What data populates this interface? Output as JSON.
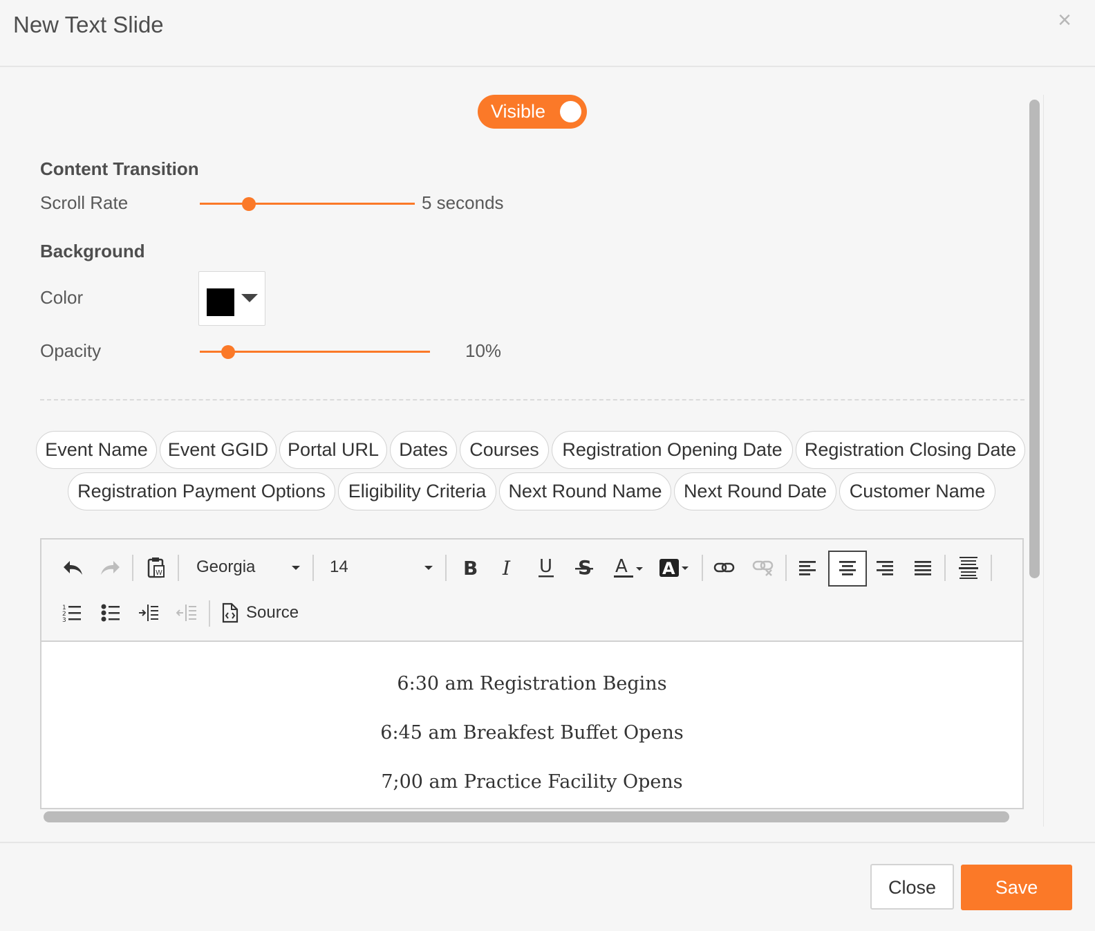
{
  "dialog": {
    "title": "New Text Slide",
    "close_icon": "×"
  },
  "toggle": {
    "label": "Visible",
    "state": "on",
    "color": "#fb7928"
  },
  "content_transition": {
    "heading": "Content Transition",
    "scroll_rate_label": "Scroll Rate",
    "scroll_rate_value": "5 seconds",
    "scroll_rate_fraction": 0.23
  },
  "background": {
    "heading": "Background",
    "color_label": "Color",
    "color_value": "#000000",
    "opacity_label": "Opacity",
    "opacity_value": "10%",
    "opacity_fraction": 0.1
  },
  "merge_fields": [
    "Event Name",
    "Event GGID",
    "Portal URL",
    "Dates",
    "Courses",
    "Registration Opening Date",
    "Registration Closing Date",
    "Registration Payment Options",
    "Eligibility Criteria",
    "Next Round Name",
    "Next Round Date",
    "Customer Name"
  ],
  "toolbar": {
    "font_family": "Georgia",
    "font_size": "14",
    "source_label": "Source",
    "icons": [
      "undo-icon",
      "redo-icon",
      "paste-from-word-icon",
      "bold-icon",
      "italic-icon",
      "underline-icon",
      "strikethrough-icon",
      "text-color-icon",
      "background-color-icon",
      "link-icon",
      "unlink-icon",
      "align-left-icon",
      "align-center-icon",
      "align-right-icon",
      "align-justify-icon",
      "horizontal-rule-icon",
      "numbered-list-icon",
      "bulleted-list-icon",
      "indent-icon",
      "outdent-icon",
      "source-icon"
    ]
  },
  "editor_content": [
    "6:30 am Registration Begins",
    "6:45 am Breakfest Buffet Opens",
    "7;00 am Practice Facility Opens"
  ],
  "footer": {
    "close_label": "Close",
    "save_label": "Save"
  }
}
